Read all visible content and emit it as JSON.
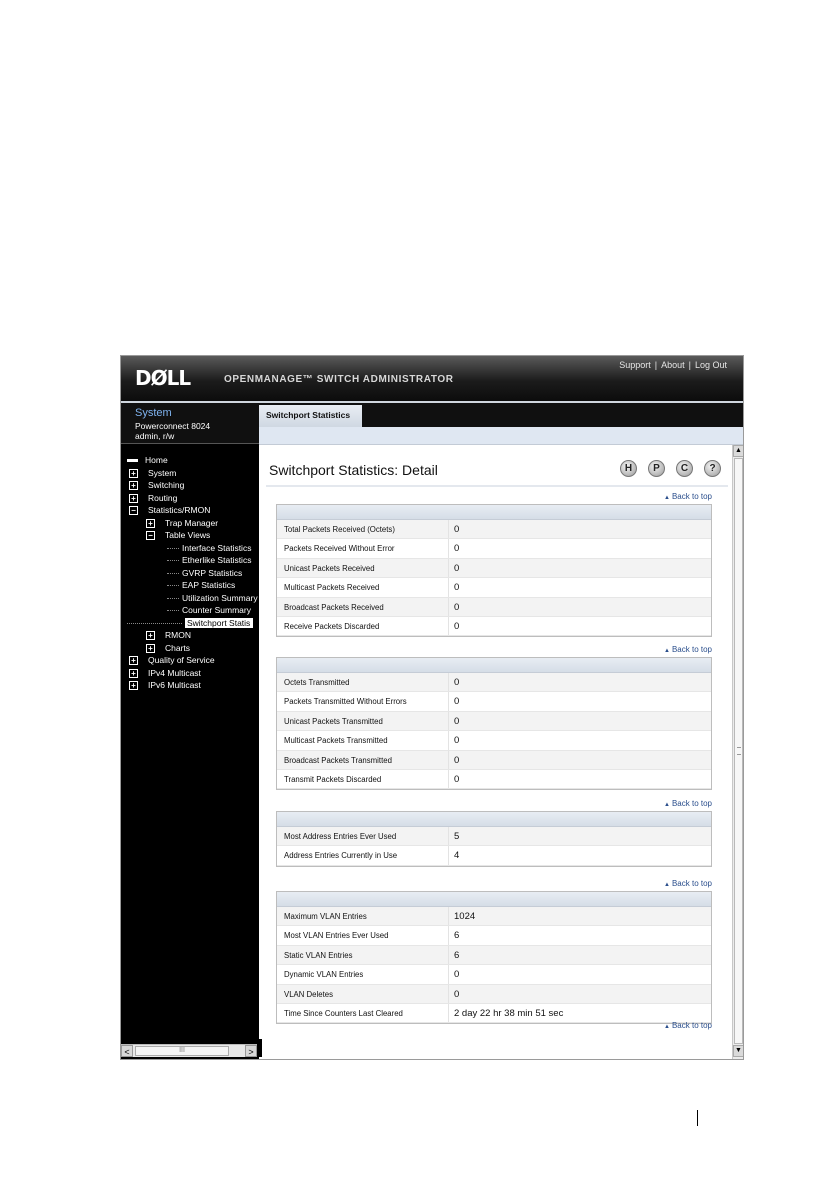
{
  "header": {
    "logo": "DØLL",
    "app_title": "OPENMANAGE™ SWITCH ADMINISTRATOR",
    "links": [
      "Support",
      "About",
      "Log Out"
    ],
    "link_separator": "|"
  },
  "system": {
    "title": "System",
    "model": "Powerconnect 8024",
    "user": "admin, r/w"
  },
  "tree": {
    "home": "Home",
    "system": "System",
    "switching": "Switching",
    "routing": "Routing",
    "stats_rmon": "Statistics/RMON",
    "trap_manager": "Trap Manager",
    "table_views": "Table Views",
    "interface_stats": "Interface Statistics",
    "etherlike_stats": "Etherlike Statistics",
    "gvrp_stats": "GVRP Statistics",
    "eap_stats": "EAP Statistics",
    "utilization_summary": "Utilization Summary",
    "counter_summary": "Counter Summary",
    "switchport_stats": "Switchport Statis",
    "rmon": "RMON",
    "charts": "Charts",
    "qos": "Quality of Service",
    "ipv4_multicast": "IPv4 Multicast",
    "ipv6_multicast": "IPv6 Multicast",
    "expand_sign": "+",
    "collapse_sign": "−"
  },
  "scrollbar": {
    "left_arrow": "<",
    "right_arrow": ">",
    "thumb_grip": "III",
    "up_arrow": "▲",
    "down_arrow": "▼"
  },
  "tab": {
    "label": "Switchport Statistics"
  },
  "page": {
    "title": "Switchport Statistics: Detail",
    "tools": [
      "H",
      "P",
      "C",
      "?"
    ],
    "back_to_top": "Back to top"
  },
  "tables": {
    "received": [
      {
        "label": "Total Packets Received (Octets)",
        "value": "0"
      },
      {
        "label": "Packets Received Without Error",
        "value": "0"
      },
      {
        "label": "Unicast Packets Received",
        "value": "0"
      },
      {
        "label": "Multicast Packets Received",
        "value": "0"
      },
      {
        "label": "Broadcast Packets Received",
        "value": "0"
      },
      {
        "label": "Receive Packets Discarded",
        "value": "0"
      }
    ],
    "transmitted": [
      {
        "label": "Octets Transmitted",
        "value": "0"
      },
      {
        "label": "Packets Transmitted Without Errors",
        "value": "0"
      },
      {
        "label": "Unicast Packets Transmitted",
        "value": "0"
      },
      {
        "label": "Multicast Packets Transmitted",
        "value": "0"
      },
      {
        "label": "Broadcast Packets Transmitted",
        "value": "0"
      },
      {
        "label": "Transmit Packets Discarded",
        "value": "0"
      }
    ],
    "address": [
      {
        "label": "Most Address Entries Ever Used",
        "value": "5"
      },
      {
        "label": "Address Entries Currently in Use",
        "value": "4"
      }
    ],
    "vlan": [
      {
        "label": "Maximum VLAN Entries",
        "value": "1024"
      },
      {
        "label": "Most VLAN Entries Ever Used",
        "value": "6"
      },
      {
        "label": "Static VLAN Entries",
        "value": "6"
      },
      {
        "label": "Dynamic VLAN Entries",
        "value": "0"
      },
      {
        "label": "VLAN Deletes",
        "value": "0"
      },
      {
        "label": "Time Since Counters Last Cleared",
        "value": "2 day 22 hr 38 min 51 sec"
      }
    ]
  }
}
